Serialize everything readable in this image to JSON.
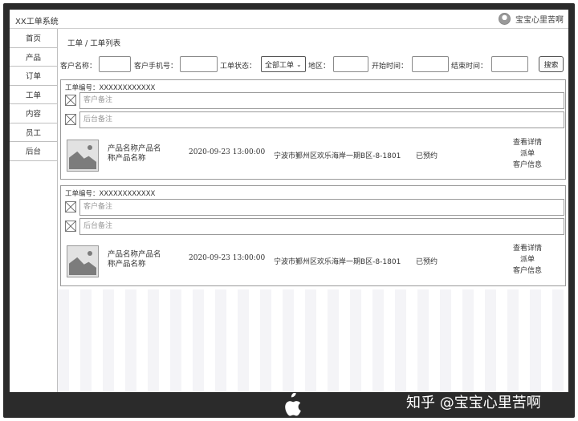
{
  "app": {
    "title": "XX工单系统",
    "user_name": "宝宝心里苦啊"
  },
  "sidebar": {
    "items": [
      {
        "label": "首页"
      },
      {
        "label": "产品"
      },
      {
        "label": "订单"
      },
      {
        "label": "工单"
      },
      {
        "label": "内容"
      },
      {
        "label": "员工"
      },
      {
        "label": "后台"
      }
    ]
  },
  "breadcrumb": "工单 / 工单列表",
  "filters": {
    "customer_name_label": "客户名称：",
    "customer_phone_label": "客户手机号：",
    "status_label": "工单状态：",
    "status_value": "全部工单",
    "region_label": "地区：",
    "start_label": "开始时间：",
    "end_label": "结束时间：",
    "search_label": "搜索"
  },
  "orders": [
    {
      "id_text": "工单编号：XXXXXXXXXXXX",
      "customer_note": "客户备注",
      "admin_note": "后台备注",
      "product_name": "产品名称产品名称产品名称",
      "time": "2020-09-23 13:00:00",
      "address": "宁波市鄞州区欢乐海岸一期B区-8-1801",
      "status": "已预约",
      "actions": [
        "查看详情",
        "派单",
        "客户信息"
      ]
    },
    {
      "id_text": "工单编号：XXXXXXXXXXXX",
      "customer_note": "客户备注",
      "admin_note": "后台备注",
      "product_name": "产品名称产品名称产品名称",
      "time": "2020-09-23 13:00:00",
      "address": "宁波市鄞州区欢乐海岸一期B区-8-1801",
      "status": "已预约",
      "actions": [
        "查看详情",
        "派单",
        "客户信息"
      ]
    }
  ],
  "watermark": "知乎 @宝宝心里苦啊",
  "icons": [
    "user-avatar-icon",
    "image-placeholder-icon",
    "broken-image-icon",
    "chevron-down-icon",
    "apple-logo-icon"
  ]
}
